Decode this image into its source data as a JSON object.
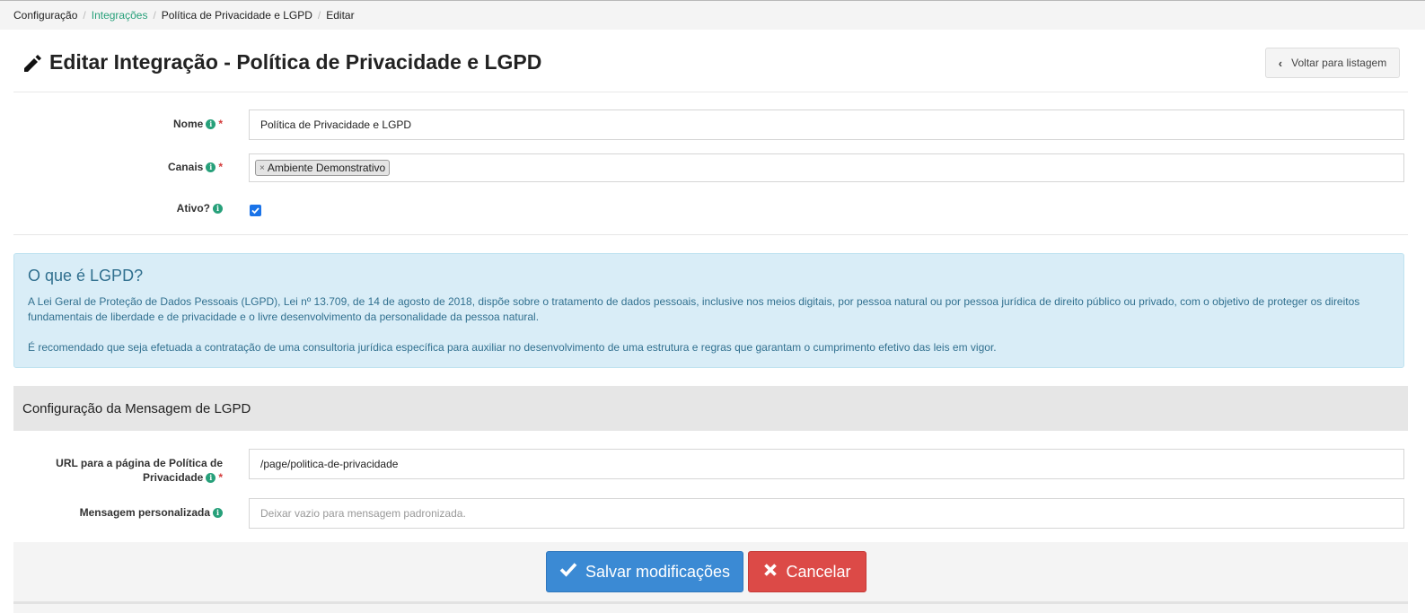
{
  "breadcrumb": {
    "items": [
      {
        "label": "Configuração",
        "link": false
      },
      {
        "label": "Integrações",
        "link": true
      },
      {
        "label": "Política de Privacidade e LGPD",
        "link": false
      },
      {
        "label": "Editar",
        "link": false
      }
    ],
    "separator": "/"
  },
  "header": {
    "title": "Editar Integração - Política de Privacidade e LGPD",
    "back_label": "Voltar para listagem"
  },
  "form": {
    "nome": {
      "label": "Nome",
      "value": "Política de Privacidade e LGPD",
      "required_mark": "*"
    },
    "canais": {
      "label": "Canais",
      "tag": "Ambiente Demonstrativo",
      "tag_remove": "×",
      "required_mark": "*"
    },
    "ativo": {
      "label": "Ativo?",
      "checked": true
    }
  },
  "alert": {
    "title": "O que é LGPD?",
    "paragraph1": "A Lei Geral de Proteção de Dados Pessoais (LGPD), Lei nº 13.709, de 14 de agosto de 2018, dispõe sobre o tratamento de dados pessoais, inclusive nos meios digitais, por pessoa natural ou por pessoa jurídica de direito público ou privado, com o objetivo de proteger os direitos fundamentais de liberdade e de privacidade e o livre desenvolvimento da personalidade da pessoa natural.",
    "paragraph2": "É recomendado que seja efetuada a contratação de uma consultoria jurídica específica para auxiliar no desenvolvimento de uma estrutura e regras que garantam o cumprimento efetivo das leis em vigor."
  },
  "section": {
    "title": "Configuração da Mensagem de LGPD"
  },
  "lgpd_form": {
    "url": {
      "label_line1": "URL para a página de Política de",
      "label_line2": "Privacidade",
      "value": "/page/politica-de-privacidade",
      "required_mark": "*"
    },
    "mensagem": {
      "label": "Mensagem personalizada",
      "placeholder": "Deixar vazio para mensagem padronizada."
    }
  },
  "actions": {
    "save_label": "Salvar modificações",
    "cancel_label": "Cancelar"
  },
  "colors": {
    "accent_green": "#27a07a",
    "primary_blue": "#3b8ad4",
    "danger_red": "#dc4a47",
    "info_bg": "#d9edf7",
    "info_text": "#31708f"
  }
}
